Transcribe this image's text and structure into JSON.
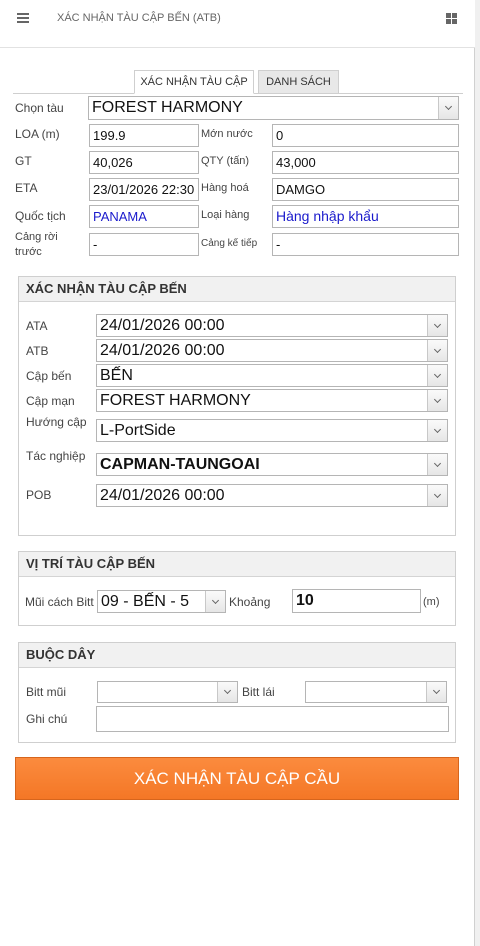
{
  "header": {
    "title": "XÁC NHẬN TÀU CẬP BẾN (ATB)",
    "menu_icon": "hamburger-menu-icon",
    "apps_icon": "grid-apps-icon"
  },
  "tabs": [
    {
      "label": "XÁC NHẬN TÀU CẬP",
      "active": true
    },
    {
      "label": "DANH SÁCH",
      "active": false
    }
  ],
  "vessel": {
    "chon_tau": {
      "label": "Chọn tàu",
      "value": "FOREST HARMONY"
    },
    "loa": {
      "label": "LOA (m)",
      "value": "199.9"
    },
    "mon_nuoc": {
      "label": "Mớn nước",
      "value": "0"
    },
    "gt": {
      "label": "GT",
      "value": "40,026"
    },
    "qty": {
      "label": "QTY (tấn)",
      "value": "43,000"
    },
    "eta": {
      "label": "ETA",
      "value": "23/01/2026 22:30"
    },
    "hang_hoa": {
      "label": "Hàng hoá",
      "value": "DAMGO"
    },
    "quoc_tich": {
      "label": "Quốc tịch",
      "value": "PANAMA"
    },
    "loai_hang": {
      "label": "Loại hàng",
      "value": "Hàng nhập khẩu"
    },
    "cang_roi_line1": "Cảng rời",
    "cang_roi_line2": "trước",
    "cang_roi_value": "-",
    "cang_ke_tiep": {
      "label": "Cảng kế tiếp",
      "value": "-"
    }
  },
  "berthing": {
    "title": "XÁC NHẬN TÀU CẬP BẾN",
    "ata": {
      "label": "ATA",
      "value": "24/01/2026 00:00"
    },
    "atb": {
      "label": "ATB",
      "value": "24/01/2026 00:00"
    },
    "cap_ben": {
      "label": "Cập bến",
      "value": "BẾN"
    },
    "cap_man": {
      "label": "Cập mạn",
      "value": "FOREST HARMONY"
    },
    "huong_cap": {
      "label": "Hướng cập",
      "value": "L-PortSide"
    },
    "tac_nghiep": {
      "label": "Tác nghiệp",
      "value": "CAPMAN-TAUNGOAI"
    },
    "pob": {
      "label": "POB",
      "value": "24/01/2026 00:00"
    }
  },
  "position": {
    "title": "VỊ TRÍ TÀU CẬP BẾN",
    "mui_cach_bitt": {
      "label": "Mũi cách Bitt",
      "value": "09 - BẾN - 5"
    },
    "khoang": {
      "label": "Khoảng",
      "value": "10",
      "unit": "(m)"
    }
  },
  "mooring": {
    "title": "BUỘC DÂY",
    "bitt_mui": {
      "label": "Bitt mũi",
      "value": ""
    },
    "bitt_lai": {
      "label": "Bitt lái",
      "value": ""
    },
    "ghi_chu": {
      "label": "Ghi chú",
      "value": ""
    }
  },
  "submit_label": "XÁC NHẬN TÀU CẬP CẦU",
  "colors": {
    "accent": "#f47726",
    "link_blue": "#1a1acc"
  }
}
